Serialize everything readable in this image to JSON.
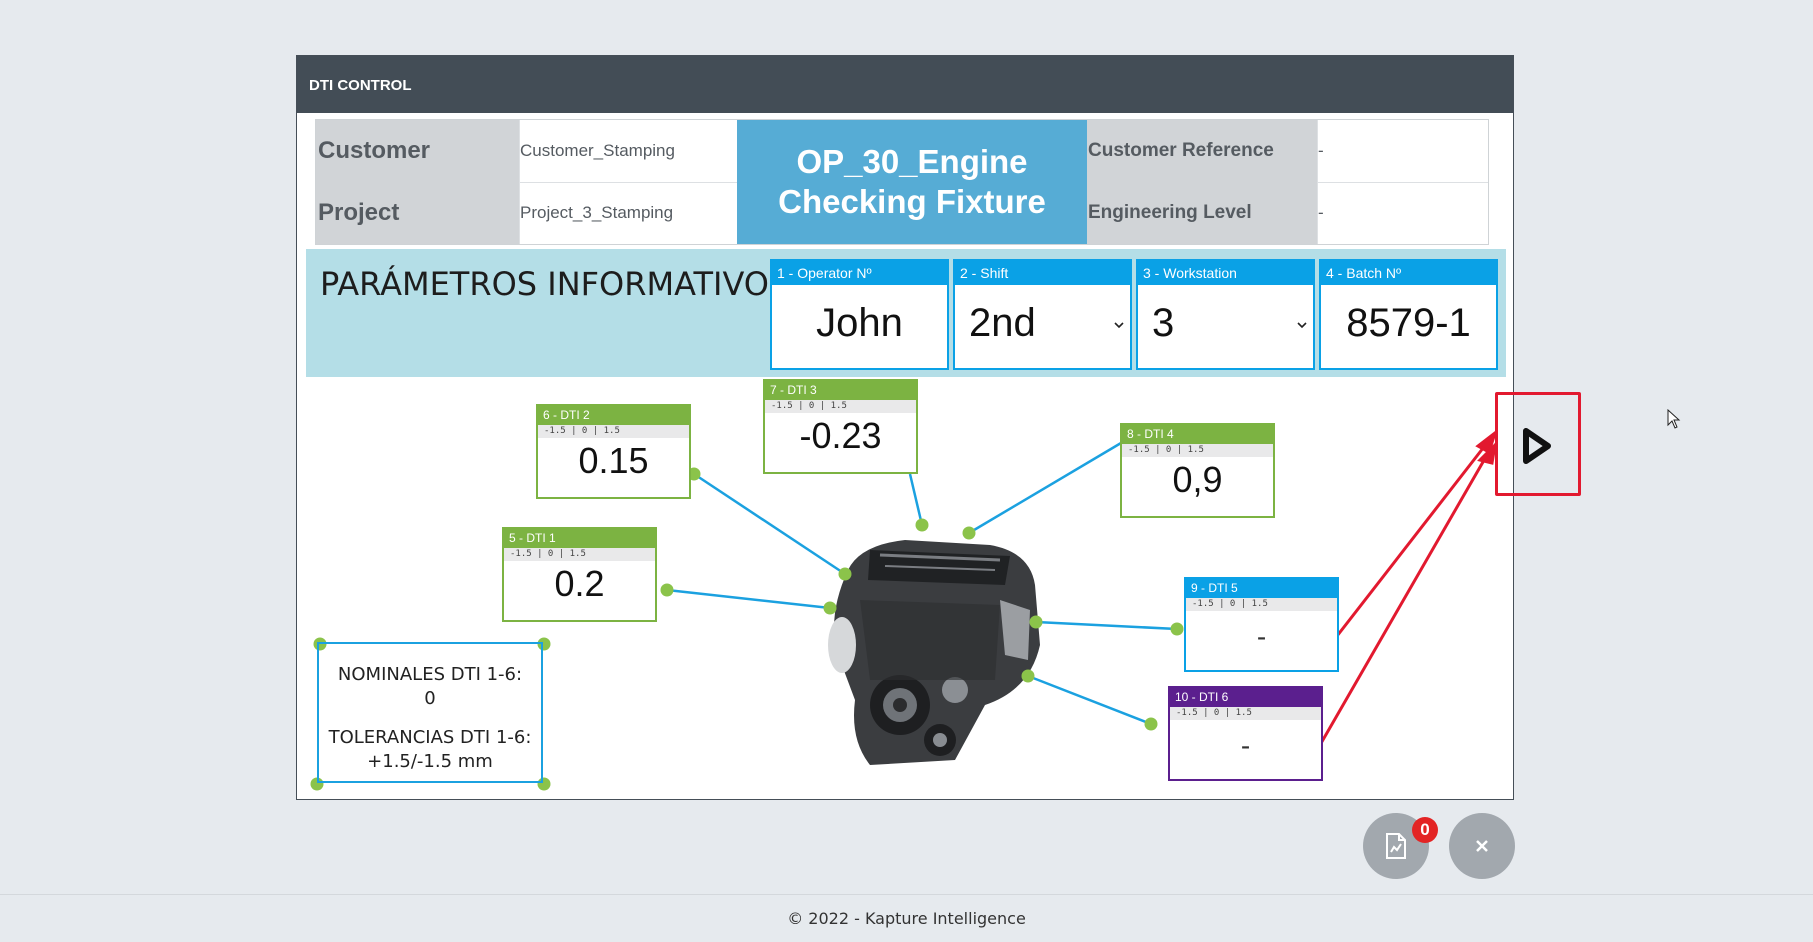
{
  "panel": {
    "title": "DTI CONTROL"
  },
  "info": {
    "customer_label": "Customer",
    "customer_value": "Customer_Stamping",
    "project_label": "Project",
    "project_value": "Project_3_Stamping",
    "fixture_title_line1": "OP_30_Engine",
    "fixture_title_line2": "Checking Fixture",
    "customer_ref_label": "Customer Reference",
    "customer_ref_value": "-",
    "eng_level_label": "Engineering Level",
    "eng_level_value": "-"
  },
  "params": {
    "title": "PARÁMETROS INFORMATIVOS:",
    "fields": [
      {
        "label": "1 - Operator Nº",
        "value": "John"
      },
      {
        "label": "2 - Shift",
        "value": "2nd"
      },
      {
        "label": "3 - Workstation",
        "value": "3"
      },
      {
        "label": "4 - Batch Nº",
        "value": "8579-1"
      }
    ]
  },
  "dtis": [
    {
      "label": "5 - DTI 1",
      "tol": "-1.5 | 0 | 1.5",
      "value": "0.2",
      "color": "#7cb342"
    },
    {
      "label": "6 - DTI 2",
      "tol": "-1.5 | 0 | 1.5",
      "value": "0.15",
      "color": "#7cb342"
    },
    {
      "label": "7 - DTI 3",
      "tol": "-1.5 | 0 | 1.5",
      "value": "-0.23",
      "color": "#7cb342"
    },
    {
      "label": "8 - DTI 4",
      "tol": "-1.5 | 0 | 1.5",
      "value": "0,9",
      "color": "#7cb342"
    },
    {
      "label": "9 - DTI 5",
      "tol": "-1.5 | 0 | 1.5",
      "value": "-",
      "color": "#0aa1e6"
    },
    {
      "label": "10 - DTI 6",
      "tol": "-1.5 | 0 | 1.5",
      "value": "-",
      "color": "#5b1f8e"
    }
  ],
  "notes": {
    "line1": "NOMINALES DTI 1-6:",
    "line2": "0",
    "line3": "TOLERANCIAS DTI 1-6:",
    "line4": "+1.5/-1.5 mm"
  },
  "report": {
    "badge_count": "0"
  },
  "footer": {
    "text": "© 2022 - Kapture Intelligence"
  },
  "colors": {
    "header": "#434d56",
    "accent_blue": "#0aa1e6",
    "dti_ok": "#7cb342",
    "dti_purple": "#5b1f8e",
    "annotation_red": "#e2192f",
    "connector_dot": "#8bc34a"
  },
  "icons": [
    "caret-down-icon",
    "report-file-icon",
    "close-icon",
    "play-next-icon",
    "engine-image",
    "mouse-cursor-icon"
  ]
}
